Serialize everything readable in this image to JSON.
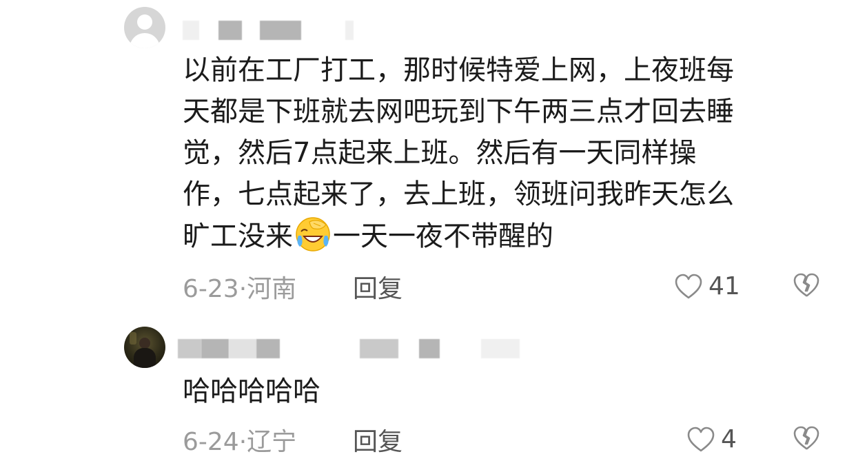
{
  "comments": [
    {
      "text_lines": [
        "以前在工厂打工，那时候特爱上网，上夜班每",
        "天都是下班就去网吧玩到下午两三点才回去睡",
        "觉，然后7点起来上班。然后有一天同样操",
        "作，七点起来了，去上班，领班问我昨天怎么",
        "旷工没来",
        "一天一夜不带醒的"
      ],
      "emoji": "laughing-crying-emoji",
      "date": "6-23",
      "location": "河南",
      "reply_label": "回复",
      "likes": "41"
    },
    {
      "text_lines": [
        "哈哈哈哈哈"
      ],
      "date": "6-24",
      "location": "辽宁",
      "reply_label": "回复",
      "likes": "4"
    }
  ],
  "separator": "·",
  "colors": {
    "text": "#1b1b1b",
    "meta": "#9b9b9b",
    "action": "#555555",
    "icon": "#8a8a8a",
    "background": "#ffffff"
  }
}
